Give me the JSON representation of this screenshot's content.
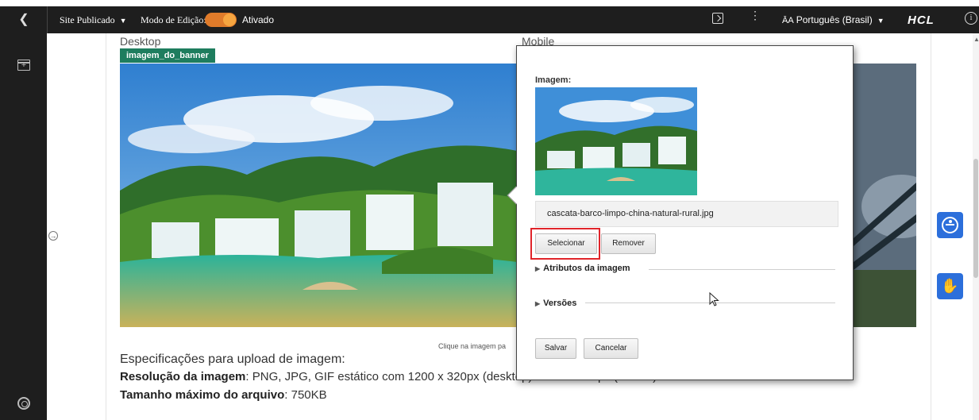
{
  "topbar": {
    "back_icon": "chevron-left-icon",
    "site_status": "Site Publicado",
    "edit_mode_label": "Modo de Edição:",
    "edit_mode_value": "Ativado",
    "language": "Português (Brasil)",
    "logo": "HCL",
    "toggle_color": "#e07b2a"
  },
  "sidebar": {
    "add_icon": "add-panel-icon",
    "help_icon": "lifebuoy-icon"
  },
  "content": {
    "desktop_label": "Desktop",
    "mobile_label": "Mobile",
    "banner_tag": "imagem_do_banner",
    "caption": "Clique na imagem pa",
    "spec_title": "Especificações para upload de imagem:",
    "spec_resolution_label": "Resolução da imagem",
    "spec_resolution_value": ": PNG, JPG, GIF estático com 1200 x 320px (desktop) e 500 x 320px (mobile)",
    "spec_size_label": "Tamanho máximo do arquivo",
    "spec_size_value": ": 750KB"
  },
  "dialog": {
    "image_label": "Imagem:",
    "filename": "cascata-barco-limpo-china-natural-rural.jpg",
    "select_button": "Selecionar",
    "remove_button": "Remover",
    "attributes_section": "Atributos da imagem",
    "versions_section": "Versões",
    "save_button": "Salvar",
    "cancel_button": "Cancelar",
    "highlight_color": "#e0242a"
  },
  "floating": {
    "accessibility_icon": "accessibility-icon",
    "sign_language_icon": "sign-language-icon",
    "button_color": "#2c6fdb"
  }
}
